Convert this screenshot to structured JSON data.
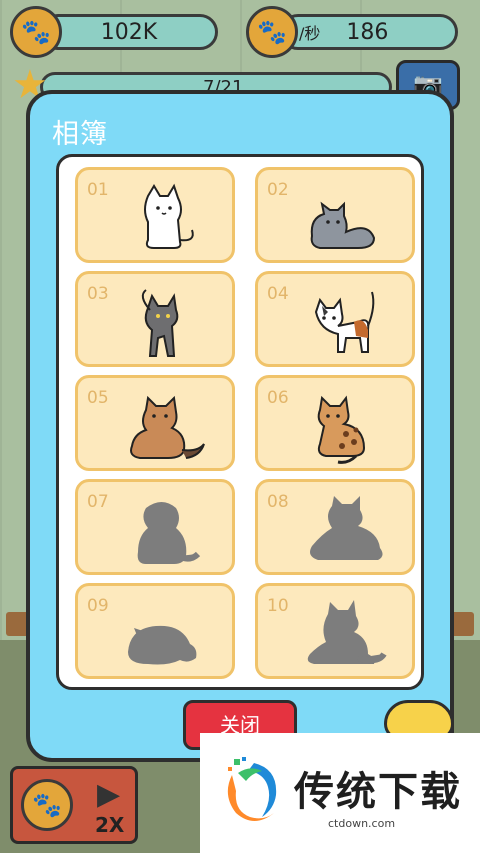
{
  "hud": {
    "coins_value": "102K",
    "rate_unit": "/秒",
    "rate_value": "186",
    "level_progress_text": "7/21",
    "speed_label": "2X"
  },
  "album": {
    "title": "相簿",
    "close_label": "关闭",
    "cards": [
      {
        "num": "01",
        "unlocked": true,
        "cat": "white-cat-sitting"
      },
      {
        "num": "02",
        "unlocked": true,
        "cat": "gray-cat-lying"
      },
      {
        "num": "03",
        "unlocked": true,
        "cat": "dark-gray-cat-standing"
      },
      {
        "num": "04",
        "unlocked": true,
        "cat": "calico-cat-standing"
      },
      {
        "num": "05",
        "unlocked": true,
        "cat": "longhair-tabby-cat-lying"
      },
      {
        "num": "06",
        "unlocked": true,
        "cat": "bengal-cat-sitting"
      },
      {
        "num": "07",
        "unlocked": false,
        "cat": "silhouette-fluffy-cat"
      },
      {
        "num": "08",
        "unlocked": false,
        "cat": "silhouette-longhair-cat"
      },
      {
        "num": "09",
        "unlocked": false,
        "cat": "silhouette-round-cat"
      },
      {
        "num": "10",
        "unlocked": false,
        "cat": "silhouette-maine-coon"
      }
    ]
  },
  "watermark": {
    "name": "传统下载",
    "url": "ctdown.com"
  },
  "colors": {
    "album_bg": "#7fdaf7",
    "card_bg": "#fde9bd",
    "card_border": "#f0c36a",
    "close_button": "#e53340",
    "silhouette": "#7d7d7d"
  }
}
